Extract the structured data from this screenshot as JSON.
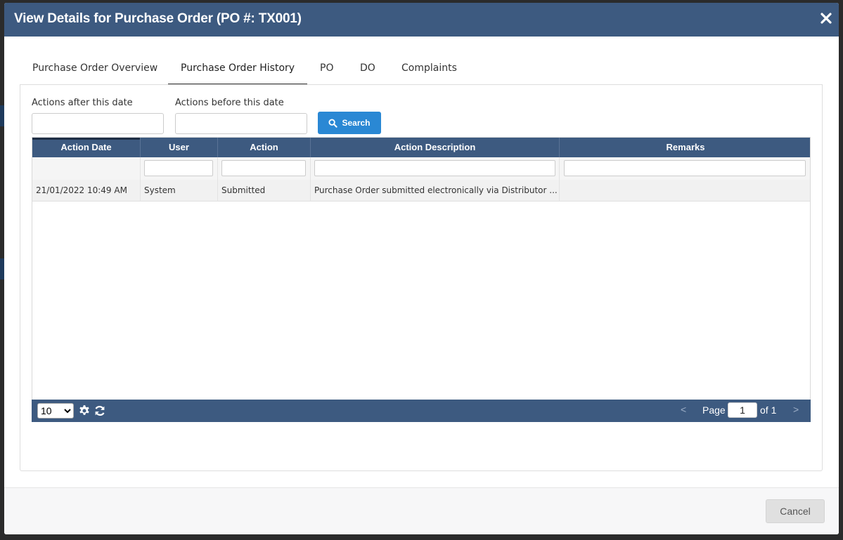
{
  "modal": {
    "title": "View Details for Purchase Order (PO #: TX001)",
    "close_icon": "close-icon"
  },
  "tabs": [
    {
      "label": "Purchase Order Overview",
      "active": false
    },
    {
      "label": "Purchase Order History",
      "active": true
    },
    {
      "label": "PO",
      "active": false
    },
    {
      "label": "DO",
      "active": false
    },
    {
      "label": "Complaints",
      "active": false
    }
  ],
  "filters": {
    "after_label": "Actions after this date",
    "after_value": "",
    "before_label": "Actions before this date",
    "before_value": "",
    "search_label": "Search",
    "search_icon": "search-icon"
  },
  "grid": {
    "columns": [
      "Action Date",
      "User",
      "Action",
      "Action Description",
      "Remarks"
    ],
    "rows": [
      {
        "action_date": "21/01/2022 10:49 AM",
        "user": "System",
        "action": "Submitted",
        "description": "Purchase Order submitted electronically via Distributor ...",
        "remarks": ""
      }
    ]
  },
  "pager": {
    "page_size": "10",
    "page_size_options": [
      "10"
    ],
    "page_label": "Page",
    "current_page": "1",
    "of_label": "of 1",
    "prev": "<",
    "next": ">",
    "settings_icon": "gear-icon",
    "refresh_icon": "refresh-icon"
  },
  "footer": {
    "cancel_label": "Cancel"
  },
  "colors": {
    "header": "#3d5a80",
    "search_button": "#2a88d4",
    "cancel_button": "#e0e0e0"
  }
}
